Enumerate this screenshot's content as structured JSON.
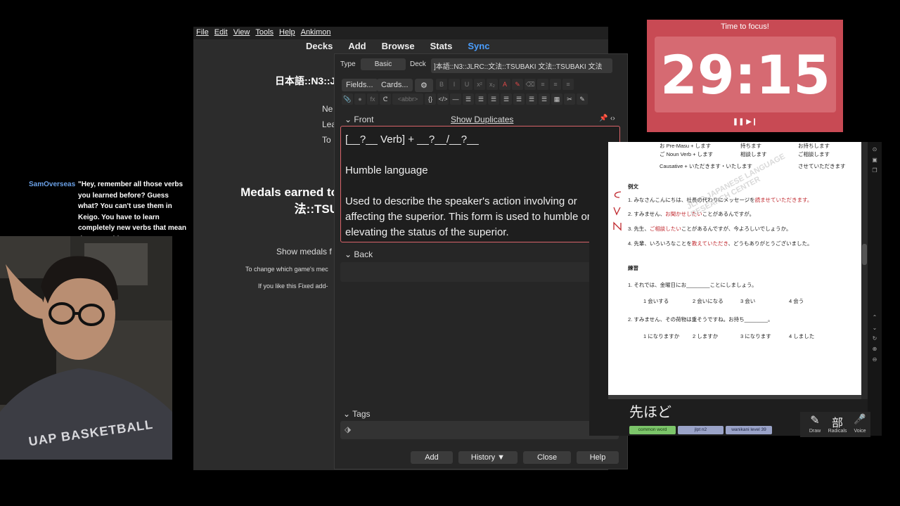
{
  "anki_main": {
    "menu": [
      "File",
      "Edit",
      "View",
      "Tools",
      "Help",
      "Ankimon"
    ],
    "nav": [
      "Decks",
      "Add",
      "Browse",
      "Stats",
      "Sync"
    ],
    "deck_title": "日本語::N3::J",
    "stats": [
      "Ne",
      "Lea",
      "To"
    ],
    "medals_heading_line1": "Medals earned to",
    "medals_heading_line2": "法::TSU",
    "show_medals": "Show medals f",
    "change_note": "To change which game's mec",
    "like_note": "If you like this Fixed add-"
  },
  "add_dialog": {
    "type_label": "Type",
    "type_value": "Basic",
    "deck_label": "Deck",
    "deck_value": "]本語::N3::JLRC::文法::TSUBAKI 文法::TSUBAKI 文法",
    "fields_btn": "Fields...",
    "cards_btn": "Cards...",
    "abbr": "<abbr>",
    "front_label": "Front",
    "show_duplicates": "Show Duplicates",
    "front_text": [
      "[__?__ Verb] + __?__/__?__",
      "",
      "Humble language",
      "",
      "Used to describe the speaker's action involving or affecting the superior. This form is used to humble or thus elevating the status of the superior."
    ],
    "back_label": "Back",
    "tags_label": "Tags",
    "buttons": {
      "add": "Add",
      "history": "History ▼",
      "close": "Close",
      "help": "Help"
    }
  },
  "timer": {
    "title": "Time to focus!",
    "time": "29:15",
    "controls": "❚❚ ▶❙"
  },
  "pdf": {
    "rows": [
      {
        "a": "お Pre-Masu + します",
        "b": "持ちます",
        "c": "お持ちします"
      },
      {
        "a": "ご Noun Verb + します",
        "b": "相談します",
        "c": "ご相談します"
      },
      {
        "a": "Causative + いただきます・いたします",
        "b": "",
        "c": "させていただきます"
      }
    ],
    "example_heading": "例文",
    "example_1a": "1. みなさんこんにちは、社長の代わりにメッセージを",
    "example_1b": "読ませていただきます。",
    "example_2a": "2. すみません、",
    "example_2b": "お聞かせしたい",
    "example_2c": "ことがあるんですが。",
    "example_3a": "3. 先生、",
    "example_3b": "ご相談したい",
    "example_3c": "ことがあるんですが、今よろしいでしょうか。",
    "example_4a": "4. 先輩、いろいろなことを",
    "example_4b": "教えていただき",
    "example_4c": "、どうもありがとうございました。",
    "practice_heading": "練習",
    "q1": "1. それでは、金曜日にお________ことにしましょう。",
    "q1_opts": [
      "1 会いする",
      "2 会いになる",
      "3 会い",
      "4 会う"
    ],
    "q2": "2. すみません、その荷物は重そうですね。お持ち________。",
    "q2_opts": [
      "1 になりますか",
      "2 しますか",
      "3 になります",
      "4 しました"
    ],
    "watermark": "JLRC JAPANESE LANGUAGE RESEARCH CENTER",
    "kanji_word": "先ほど",
    "tags": [
      "common word",
      "jlpt n2",
      "wanikani level 39"
    ],
    "tools": [
      "Draw",
      "Radicals",
      "Voice"
    ],
    "tool_glyphs": [
      "✎",
      "部",
      "🎤"
    ]
  },
  "chat": {
    "username": "SamOverseas",
    "message": "\"Hey, remember all those verbs you learned before? Guess what? You can't use them in Keigo. You have to learn completely new verbs that mean the same thing!\""
  },
  "webcam": {
    "shirt_text": "UAP BASKETBALL"
  }
}
